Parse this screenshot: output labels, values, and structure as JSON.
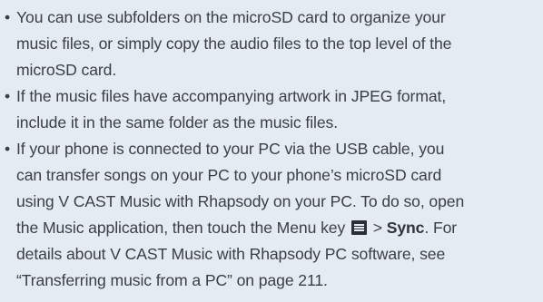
{
  "bullets": [
    {
      "lines": [
        "You can use subfolders on the microSD card to organize your",
        "music files, or simply copy the audio files to the top level of the",
        "microSD card."
      ]
    },
    {
      "lines": [
        "If the music files have accompanying artwork in JPEG format,",
        "include it in the same folder as the music files."
      ]
    },
    {
      "lines": [
        "If your phone is connected to your PC via the USB cable, you",
        "can transfer songs on your PC to your phone’s microSD card",
        "using V CAST Music with Rhapsody on your PC. To do so, open"
      ],
      "line4": {
        "before": "the Music application, then touch the Menu key",
        "icon": "menu-key-icon",
        "after": " > ",
        "bold": "Sync",
        "end": ". For"
      },
      "tail": [
        "details about V CAST Music with Rhapsody PC software, see",
        "“Transferring music from a PC” on page 211."
      ]
    }
  ],
  "bullet_char": "•",
  "colors": {
    "background": "#e4ebf3",
    "text": "#3a3f44"
  }
}
